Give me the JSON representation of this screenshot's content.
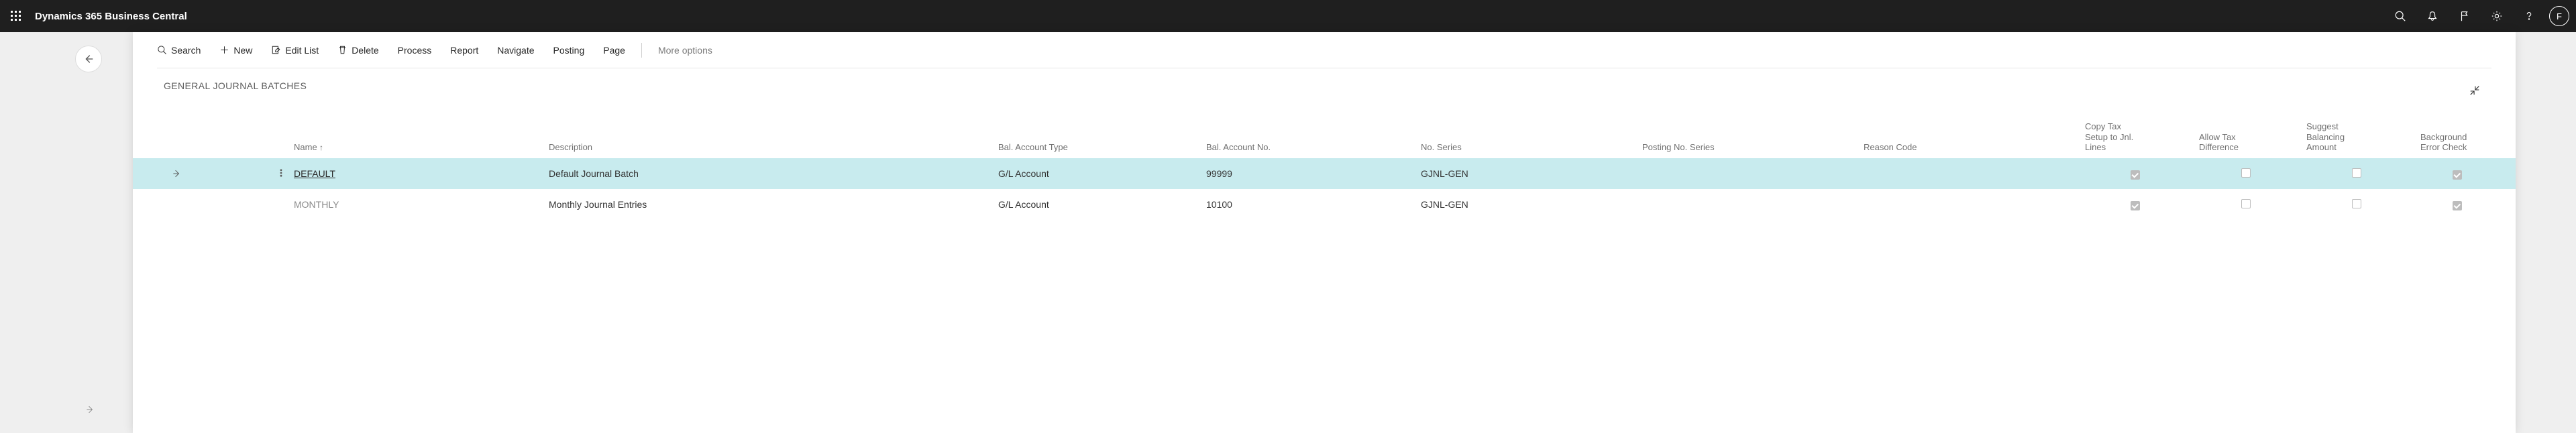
{
  "topbar": {
    "title": "Dynamics 365 Business Central",
    "avatar_initial": "F"
  },
  "toolbar": {
    "search": "Search",
    "new": "New",
    "edit_list": "Edit List",
    "delete": "Delete",
    "process": "Process",
    "report": "Report",
    "navigate": "Navigate",
    "posting": "Posting",
    "page": "Page",
    "more": "More options"
  },
  "page": {
    "title": "GENERAL JOURNAL BATCHES"
  },
  "columns": {
    "name": "Name",
    "description": "Description",
    "bal_account_type": "Bal. Account Type",
    "bal_account_no": "Bal. Account No.",
    "no_series": "No. Series",
    "posting_no_series": "Posting No. Series",
    "reason_code": "Reason Code",
    "copy_tax": "Copy Tax\nSetup to Jnl.\nLines",
    "allow_tax": "Allow Tax\nDifference",
    "suggest": "Suggest\nBalancing\nAmount",
    "background": "Background\nError Check"
  },
  "rows": [
    {
      "name": "DEFAULT",
      "description": "Default Journal Batch",
      "bal_account_type": "G/L Account",
      "bal_account_no": "99999",
      "no_series": "GJNL-GEN",
      "posting_no_series": "",
      "reason_code": "",
      "copy_tax": true,
      "allow_tax": false,
      "suggest": false,
      "background": true
    },
    {
      "name": "MONTHLY",
      "description": "Monthly Journal Entries",
      "bal_account_type": "G/L Account",
      "bal_account_no": "10100",
      "no_series": "GJNL-GEN",
      "posting_no_series": "",
      "reason_code": "",
      "copy_tax": true,
      "allow_tax": false,
      "suggest": false,
      "background": true
    }
  ]
}
